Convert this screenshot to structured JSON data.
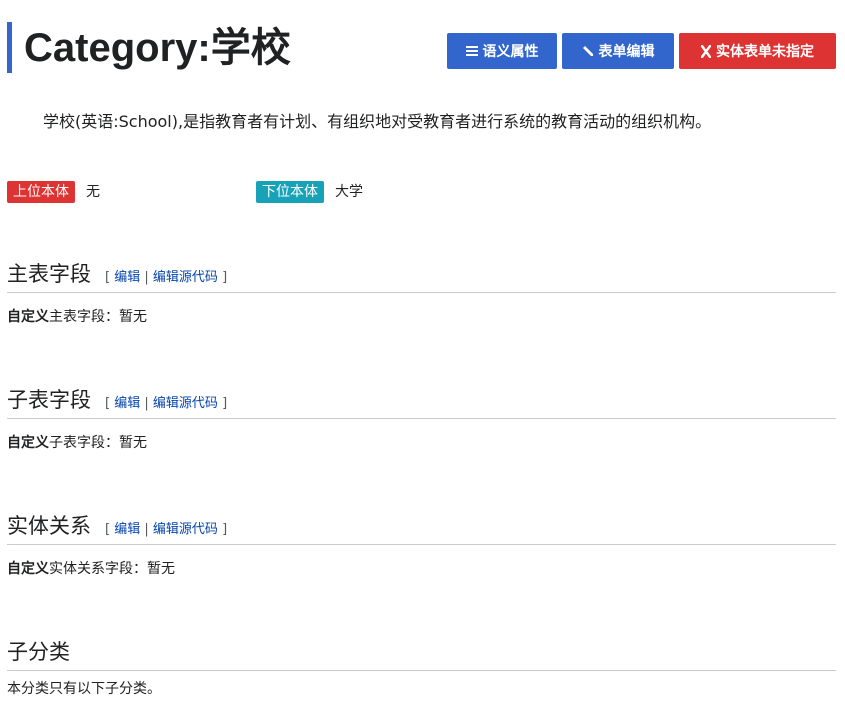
{
  "header": {
    "title": "Category:学校",
    "buttons": {
      "semantic_label": "语义属性",
      "form_edit_label": "表单编辑",
      "no_form_label": "实体表单未指定"
    }
  },
  "intro": "学校(英语:School),是指教育者有计划、有组织地对受教育者进行系统的教育活动的组织机构。",
  "ontology": {
    "parent_label": "上位本体",
    "parent_value": "无",
    "child_label": "下位本体",
    "child_value": "大学"
  },
  "edit_links": {
    "open": "[",
    "edit": "编辑",
    "sep": "|",
    "edit_source": "编辑源代码",
    "close": "]"
  },
  "sections": [
    {
      "title": "主表字段",
      "body_bold": "自定义",
      "body_text": "主表字段：暂无"
    },
    {
      "title": "子表字段",
      "body_bold": "自定义",
      "body_text": "子表字段：暂无"
    },
    {
      "title": "实体关系",
      "body_bold": "自定义",
      "body_text": "实体关系字段：暂无"
    },
    {
      "title": "子分类",
      "body_text": "本分类只有以下子分类。"
    }
  ],
  "colors": {
    "primary_blue": "#3366cc",
    "danger_red": "#dd3333",
    "teal": "#17a2b8",
    "link": "#0645ad"
  },
  "icons": {
    "semantic": "list-icon",
    "form_edit": "pencil-icon",
    "no_form": "x-icon"
  }
}
